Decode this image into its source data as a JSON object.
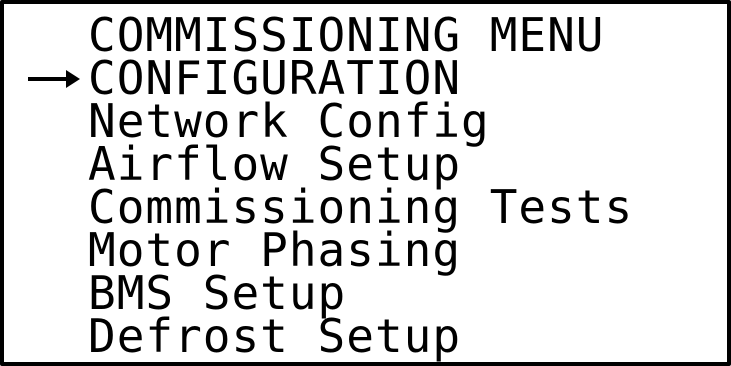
{
  "menu": {
    "title": "COMMISSIONING MENU",
    "selected_index": 0,
    "items": [
      {
        "label": "CONFIGURATION"
      },
      {
        "label": "Network Config"
      },
      {
        "label": "Airflow Setup"
      },
      {
        "label": "Commissioning Tests"
      },
      {
        "label": "Motor Phasing"
      },
      {
        "label": "BMS Setup"
      },
      {
        "label": "Defrost Setup"
      }
    ]
  },
  "cursor_icon": "right-arrow-icon",
  "colors": {
    "foreground": "#000000",
    "background": "#ffffff"
  }
}
